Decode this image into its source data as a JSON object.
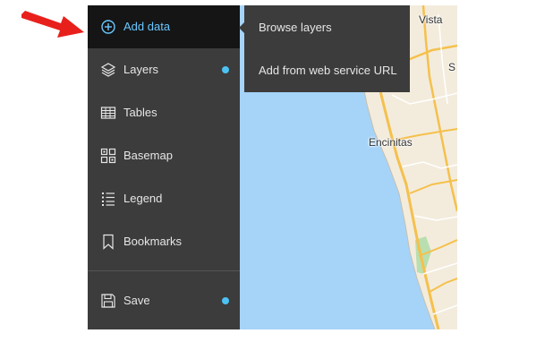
{
  "sidebar": {
    "items": [
      {
        "label": "Add data",
        "icon": "plus-circle-icon",
        "active": true
      },
      {
        "label": "Layers",
        "icon": "layers-icon",
        "dot": true
      },
      {
        "label": "Tables",
        "icon": "table-icon"
      },
      {
        "label": "Basemap",
        "icon": "basemap-grid-icon"
      },
      {
        "label": "Legend",
        "icon": "legend-list-icon"
      },
      {
        "label": "Bookmarks",
        "icon": "bookmark-icon"
      }
    ],
    "footer": {
      "label": "Save",
      "icon": "save-icon",
      "dot": true
    }
  },
  "flyout": {
    "items": [
      "Browse layers",
      "Add from web service URL"
    ]
  },
  "map": {
    "labels": {
      "vista": "Vista",
      "encinitas": "Encinitas",
      "edge_s": "S"
    }
  },
  "colors": {
    "sidebar_bg": "#3c3c3c",
    "active_bg": "#151515",
    "accent": "#6ac7ff",
    "dot": "#4cc2f2",
    "water": "#a6d3f8",
    "land": "#f3ecdd",
    "road": "#f5c04c",
    "annotation": "#e8201c"
  }
}
